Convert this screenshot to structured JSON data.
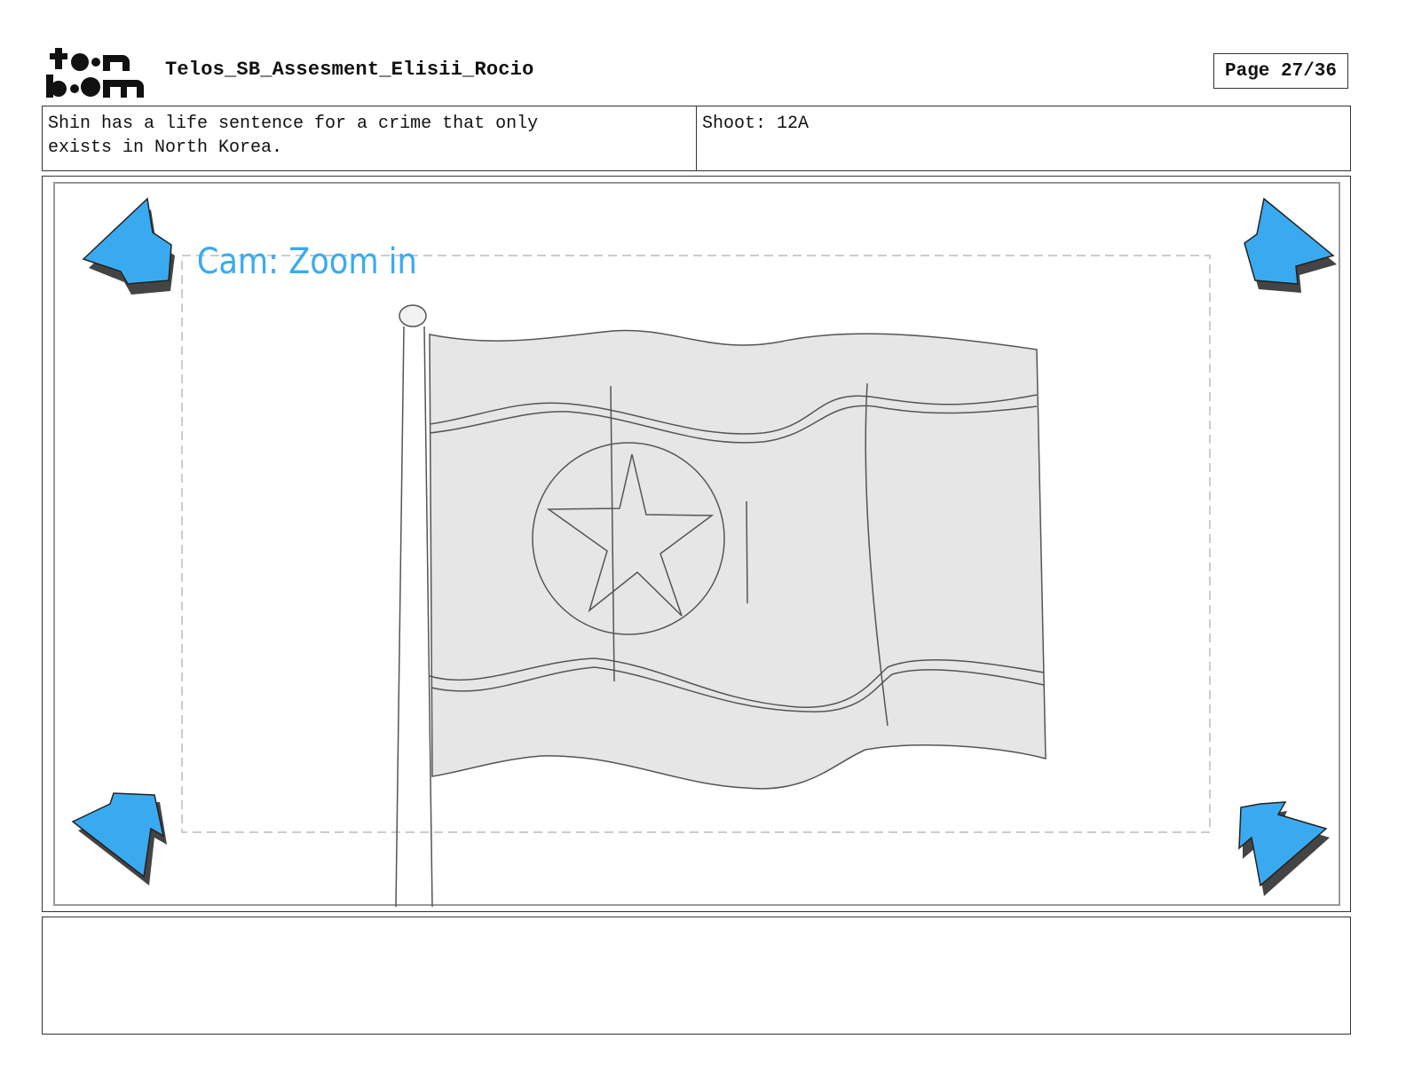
{
  "header": {
    "logo_text": "toon boom",
    "doc_title": "Telos_SB_Assesment_Elisii_Rocio",
    "page_label": "Page 27/36"
  },
  "info": {
    "description": "Shin has a life sentence for a crime that only\nexists in North Korea.",
    "shoot": "Shoot: 12A"
  },
  "panel": {
    "camera_note": "Cam: Zoom in",
    "arrow_color": "#3aaaf0",
    "note_color": "#3aaaf0",
    "flag_fill": "#e6e6e6"
  },
  "caption": {
    "text": ""
  }
}
